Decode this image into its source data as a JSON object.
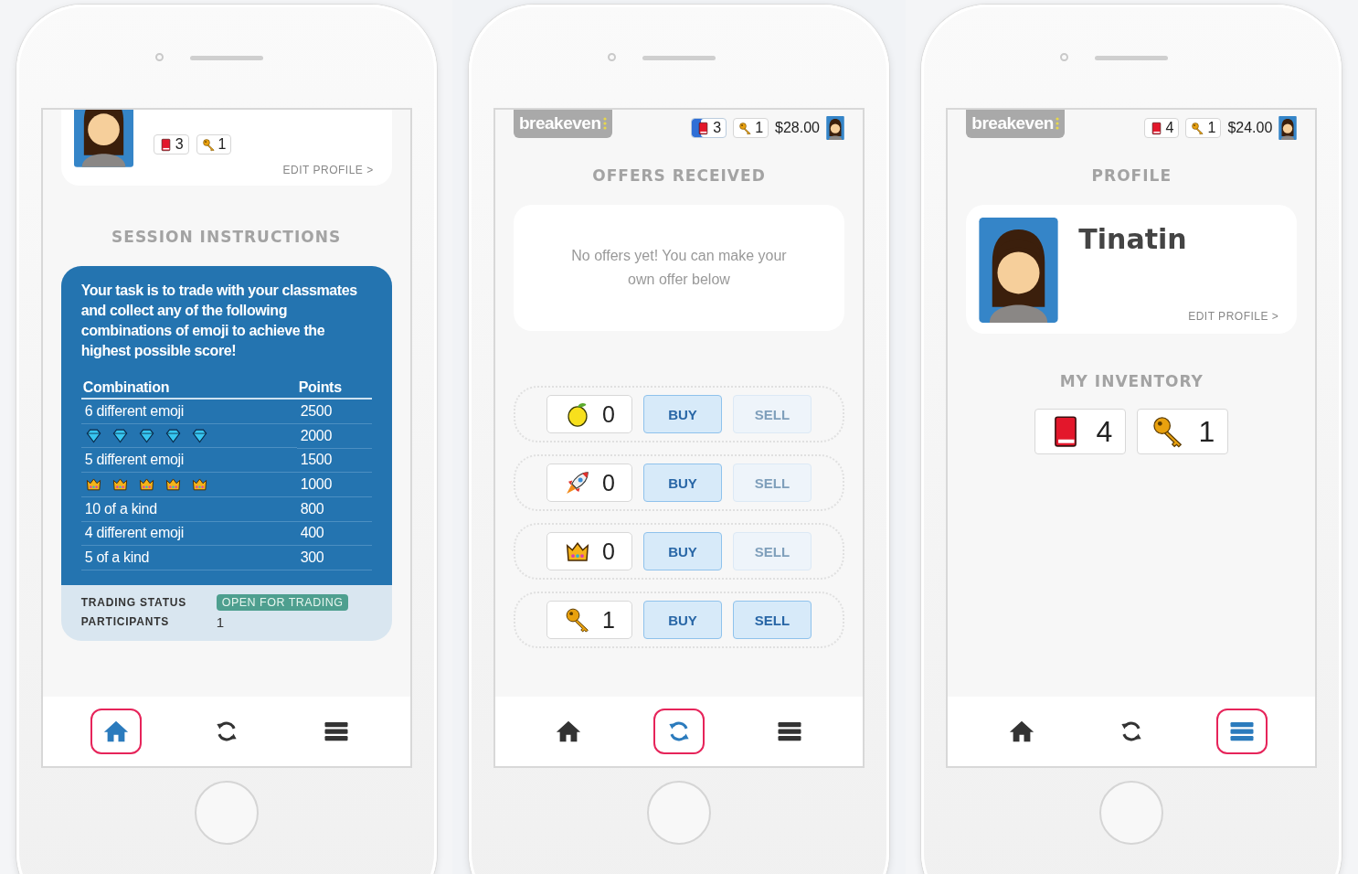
{
  "screens": [
    {
      "kind": "instructions",
      "profile_card": {
        "badges": [
          {
            "kind": "book",
            "count": "3",
            "selected": false
          },
          {
            "kind": "key",
            "count": "1",
            "selected": false
          }
        ],
        "edit_link": "EDIT PROFILE >"
      },
      "heading": "SESSION INSTRUCTIONS",
      "panel": {
        "intro": "Your task is to trade with your classmates and collect any of the following combinations of emoji to achieve the highest possible score!",
        "columns": [
          "Combination",
          "Points"
        ],
        "rows": [
          {
            "kind": "text",
            "combination": "6 different emoji",
            "points": "2500"
          },
          {
            "kind": "diamonds",
            "points": "2000"
          },
          {
            "kind": "text",
            "combination": "5 different emoji",
            "points": "1500"
          },
          {
            "kind": "crowns",
            "points": "1000"
          },
          {
            "kind": "text",
            "combination": "10 of a kind",
            "points": "800"
          },
          {
            "kind": "text",
            "combination": "4 different emoji",
            "points": "400"
          },
          {
            "kind": "text",
            "combination": "5 of a kind",
            "points": "300"
          }
        ],
        "status": [
          {
            "kind": "badge",
            "label": "TRADING STATUS",
            "value": "OPEN FOR TRADING"
          },
          {
            "kind": "text",
            "label": "PARTICIPANTS",
            "value": "1"
          }
        ]
      },
      "nav": [
        {
          "kind": "home",
          "selected": true
        },
        {
          "kind": "sync",
          "selected": false
        },
        {
          "kind": "list",
          "selected": false
        }
      ]
    },
    {
      "kind": "trade",
      "header": {
        "logo": "breakeven",
        "badges": [
          {
            "kind": "book",
            "count": "3",
            "selected": true
          },
          {
            "kind": "key",
            "count": "1",
            "selected": false
          }
        ],
        "balance": "$28.00"
      },
      "heading": "OFFERS RECEIVED",
      "empty_message": "No offers yet! You can make your own offer below",
      "items": [
        {
          "kind": "lemon",
          "count": "0",
          "buy": {
            "label": "BUY",
            "disabled": false
          },
          "sell": {
            "label": "SELL",
            "disabled": true
          }
        },
        {
          "kind": "rocket",
          "count": "0",
          "buy": {
            "label": "BUY",
            "disabled": false
          },
          "sell": {
            "label": "SELL",
            "disabled": true
          }
        },
        {
          "kind": "crown",
          "count": "0",
          "buy": {
            "label": "BUY",
            "disabled": false
          },
          "sell": {
            "label": "SELL",
            "disabled": true
          }
        },
        {
          "kind": "key",
          "count": "1",
          "buy": {
            "label": "BUY",
            "disabled": false
          },
          "sell": {
            "label": "SELL",
            "disabled": false
          }
        }
      ],
      "nav": [
        {
          "kind": "home",
          "selected": false
        },
        {
          "kind": "sync",
          "selected": true
        },
        {
          "kind": "list",
          "selected": false
        }
      ]
    },
    {
      "kind": "profile",
      "header": {
        "logo": "breakeven",
        "badges": [
          {
            "kind": "book",
            "count": "4",
            "selected": false
          },
          {
            "kind": "key",
            "count": "1",
            "selected": false
          }
        ],
        "balance": "$24.00"
      },
      "heading": "PROFILE",
      "profile": {
        "name": "Tinatin",
        "edit_link": "EDIT PROFILE >"
      },
      "inventory_heading": "MY INVENTORY",
      "inventory": [
        {
          "kind": "book",
          "count": "4"
        },
        {
          "kind": "key",
          "count": "1"
        }
      ],
      "nav": [
        {
          "kind": "home",
          "selected": false
        },
        {
          "kind": "sync",
          "selected": false
        },
        {
          "kind": "list",
          "selected": true
        }
      ]
    }
  ]
}
